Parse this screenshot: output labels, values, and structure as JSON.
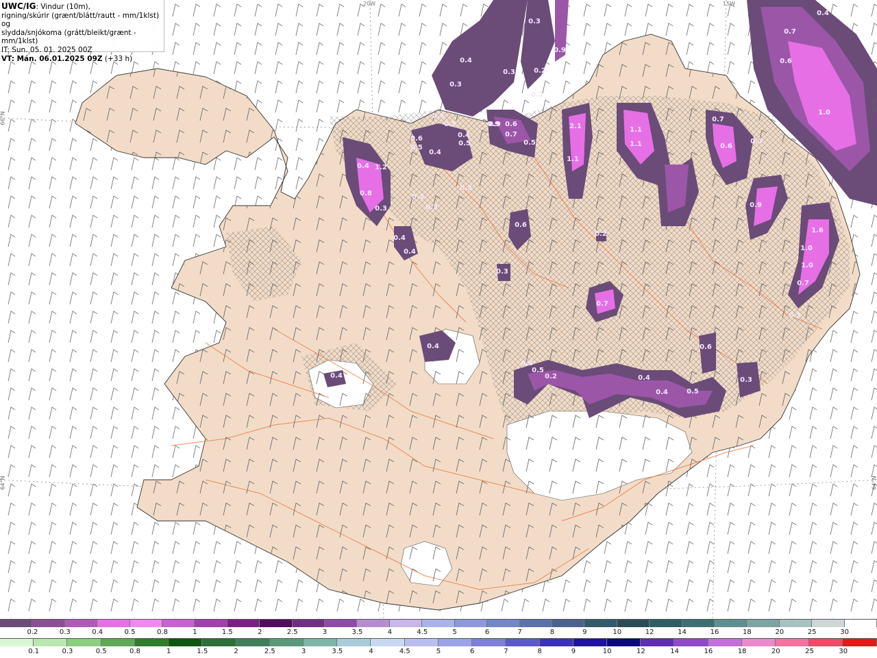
{
  "header": {
    "title": "UWC/IG",
    "line1_rest": ": Vindur (10m),",
    "line2": "rigning/skúrir (grænt/blátt/rautt - mm/1klst) og",
    "line3": "slydda/snjókoma (grátt/bleikt/grænt - mm/1klst)",
    "line4": "IT: Sun. 05. 01. 2025 00Z",
    "vt_label": "VT: Mán. 06.01.2025 09Z",
    "vt_offset": " (+33 h)"
  },
  "graticule": {
    "lat_66": "66°N",
    "lat_64": "64°N",
    "lon_top_a": "20W",
    "lon_top_b": "15W"
  },
  "colors": {
    "land": "#f2dcc8",
    "sea": "#ffffff",
    "roads": "#ee7a3c",
    "snow_light": "#6b4b78",
    "snow_mid": "#9c56a8",
    "snow_heavy": "#e66fe6"
  },
  "precip_labels": [
    {
      "v": "0.4"
    },
    {
      "v": "0.3"
    },
    {
      "v": "0.3"
    },
    {
      "v": "0.3"
    },
    {
      "v": "0.9"
    },
    {
      "v": "0.2"
    },
    {
      "v": "0.2"
    },
    {
      "v": "0.6"
    },
    {
      "v": "0.5"
    },
    {
      "v": "0.9"
    },
    {
      "v": "0.6"
    },
    {
      "v": "0.7"
    },
    {
      "v": "0.5"
    },
    {
      "v": "2.1"
    },
    {
      "v": "1.1"
    },
    {
      "v": "1.1"
    },
    {
      "v": "1.1"
    },
    {
      "v": "0.7"
    },
    {
      "v": "0.6"
    },
    {
      "v": "0.4"
    },
    {
      "v": "1.0"
    },
    {
      "v": "0.7"
    },
    {
      "v": "0.6"
    },
    {
      "v": "0.4"
    },
    {
      "v": "1.0"
    },
    {
      "v": "0.4"
    },
    {
      "v": "1.2"
    },
    {
      "v": "0.8"
    },
    {
      "v": "0.3"
    },
    {
      "v": "0.5"
    },
    {
      "v": "0.4"
    },
    {
      "v": "0.5"
    },
    {
      "v": "0.4"
    },
    {
      "v": "0.3"
    },
    {
      "v": "0.3"
    },
    {
      "v": "0.3"
    },
    {
      "v": "0.4"
    },
    {
      "v": "0.4"
    },
    {
      "v": "0.6"
    },
    {
      "v": "0.3"
    },
    {
      "v": "0.9"
    },
    {
      "v": "1.6"
    },
    {
      "v": "1.0"
    },
    {
      "v": "0.7"
    },
    {
      "v": "0.3"
    },
    {
      "v": "0.2"
    },
    {
      "v": "0.7"
    },
    {
      "v": "0.4"
    },
    {
      "v": "0.4"
    },
    {
      "v": "0.4"
    },
    {
      "v": "0.5"
    },
    {
      "v": "0.2"
    },
    {
      "v": "0.4"
    },
    {
      "v": "0.4"
    },
    {
      "v": "0.5"
    },
    {
      "v": "0.6"
    },
    {
      "v": "0.3"
    },
    {
      "v": "0.6"
    },
    {
      "v": "0.9"
    }
  ],
  "legend_snow": {
    "labels": [
      "0.2",
      "0.3",
      "0.4",
      "0.5",
      "0.8",
      "1",
      "1.5",
      "2",
      "2.5",
      "3",
      "3.5",
      "4",
      "4.5",
      "5",
      "6",
      "7",
      "8",
      "9",
      "10",
      "12",
      "14",
      "16",
      "18",
      "20",
      "25",
      "30"
    ],
    "colors": [
      "#6b4b78",
      "#8a4f94",
      "#b05ab8",
      "#e66fe6",
      "#f088f0",
      "#c861d1",
      "#a13fad",
      "#7a1f86",
      "#520e5e",
      "#6f2f85",
      "#8f4ca6",
      "#b58ccf",
      "#c9b6ea",
      "#aab2ea",
      "#8e98dc",
      "#7386c8",
      "#5a71ab",
      "#4a628c",
      "#345a6a",
      "#2b4c55",
      "#2f5d63",
      "#3d6e72",
      "#5f8e90",
      "#7da3a3",
      "#a6c2c0",
      "#ced6d6",
      "#ffffff"
    ]
  },
  "legend_rain": {
    "labels": [
      "0.1",
      "0.3",
      "0.5",
      "0.8",
      "1",
      "1.5",
      "2",
      "2.5",
      "3",
      "3.5",
      "4",
      "4.5",
      "5",
      "6",
      "7",
      "8",
      "9",
      "10",
      "12",
      "14",
      "16",
      "18",
      "20",
      "25",
      "30"
    ],
    "colors": [
      "#d9f5d2",
      "#b8e8b0",
      "#8ccf7f",
      "#5ea955",
      "#2f7d2a",
      "#0f5610",
      "#2d6f3a",
      "#3f7f5a",
      "#5a9a7a",
      "#7fb5a6",
      "#a8ccd8",
      "#c8d8f0",
      "#b8bff0",
      "#9aa3e8",
      "#7c80d8",
      "#5a5ac8",
      "#3a32b8",
      "#1d139e",
      "#0a0a7a",
      "#5e2fb0",
      "#8f49c9",
      "#c270d9",
      "#e98acb",
      "#f4739e",
      "#f04866",
      "#e81818"
    ]
  }
}
